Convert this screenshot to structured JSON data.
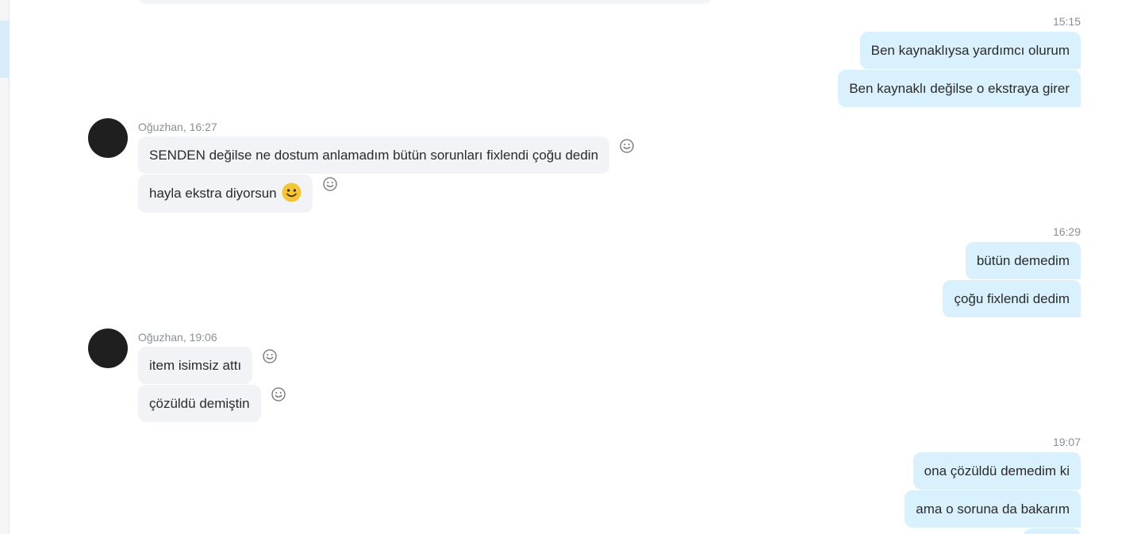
{
  "colors": {
    "outgoing_bubble": "#d9f1fd",
    "incoming_bubble": "#f1f3f6",
    "meta_text": "#8a8f95",
    "avatar": "#1f1f1f"
  },
  "messages": {
    "g1": {
      "time": "15:15",
      "m1": "Ben kaynaklıysa yardımcı olurum",
      "m2": "Ben kaynaklı değilse o ekstraya girer"
    },
    "g2": {
      "meta": "Oğuzhan, 16:27",
      "m1": "SENDEN değilse ne dostum anlamadım bütün sorunları fixlendi çoğu dedin",
      "m2": "hayla ekstra diyorsun",
      "m2_emoji": "smile-emoji"
    },
    "g3": {
      "time": "16:29",
      "m1": "bütün demedim",
      "m2": "çoğu fixlendi dedim"
    },
    "g4": {
      "meta": "Oğuzhan, 19:06",
      "m1": "item isimsiz attı",
      "m2": "çözüldü demiştin"
    },
    "g5": {
      "time": "19:07",
      "m1": "ona çözüldü demedim ki",
      "m2": "ama o soruna da bakarım"
    }
  },
  "icons": {
    "reaction": "add-reaction-icon",
    "avatar": "contact-avatar"
  }
}
